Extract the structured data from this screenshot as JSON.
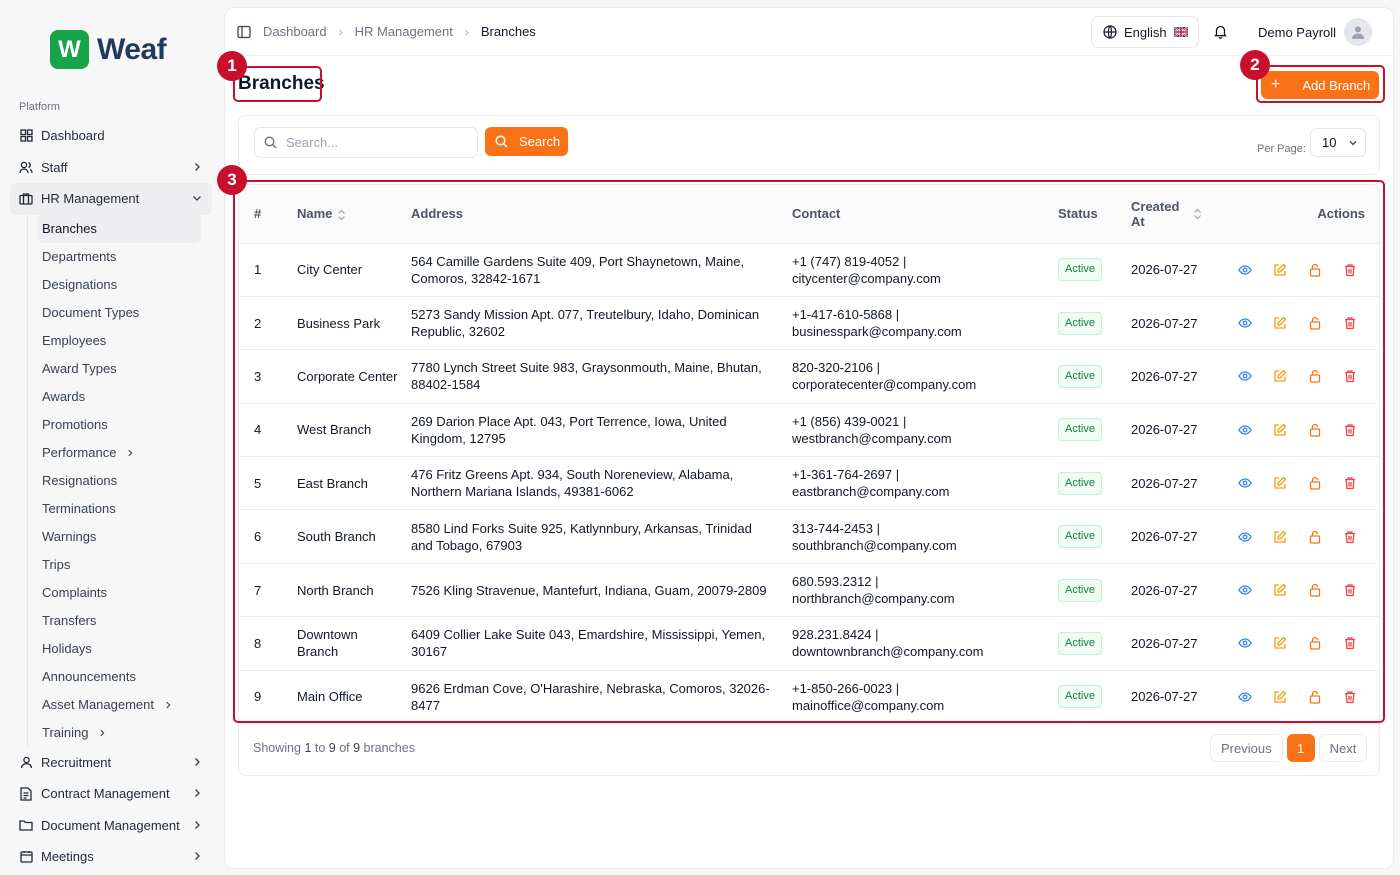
{
  "brand": {
    "logo_letter": "W",
    "name": "Weaf"
  },
  "sidebar": {
    "section_label": "Platform",
    "items": [
      {
        "label": "Dashboard"
      },
      {
        "label": "Staff"
      },
      {
        "label": "HR Management"
      }
    ],
    "hr_sub": [
      {
        "label": "Branches"
      },
      {
        "label": "Departments"
      },
      {
        "label": "Designations"
      },
      {
        "label": "Document Types"
      },
      {
        "label": "Employees"
      },
      {
        "label": "Award Types"
      },
      {
        "label": "Awards"
      },
      {
        "label": "Promotions"
      },
      {
        "label": "Performance"
      },
      {
        "label": "Resignations"
      },
      {
        "label": "Terminations"
      },
      {
        "label": "Warnings"
      },
      {
        "label": "Trips"
      },
      {
        "label": "Complaints"
      },
      {
        "label": "Transfers"
      },
      {
        "label": "Holidays"
      },
      {
        "label": "Announcements"
      },
      {
        "label": "Asset Management"
      },
      {
        "label": "Training"
      }
    ],
    "bottom_items": [
      {
        "label": "Recruitment"
      },
      {
        "label": "Contract Management"
      },
      {
        "label": "Document Management"
      },
      {
        "label": "Meetings"
      }
    ]
  },
  "topbar": {
    "breadcrumb": [
      "Dashboard",
      "HR Management",
      "Branches"
    ],
    "language": "English",
    "user_name": "Demo Payroll"
  },
  "page": {
    "title": "Branches",
    "add_button": "Add Branch",
    "search_placeholder": "Search...",
    "search_button": "Search",
    "per_page_label": "Per Page:",
    "per_page_value": "10"
  },
  "table": {
    "headers": {
      "num": "#",
      "name": "Name",
      "address": "Address",
      "contact": "Contact",
      "status": "Status",
      "created": "Created At",
      "actions": "Actions"
    },
    "rows": [
      {
        "num": "1",
        "name": "City Center",
        "address": "564 Camille Gardens Suite 409, Port Shaynetown, Maine, Comoros, 32842-1671",
        "phone": "+1 (747) 819-4052 |",
        "email": "citycenter@company.com",
        "status": "Active",
        "created": "2026-07-27"
      },
      {
        "num": "2",
        "name": "Business Park",
        "address": "5273 Sandy Mission Apt. 077, Treutelbury, Idaho, Dominican Republic, 32602",
        "phone": "+1-417-610-5868 |",
        "email": "businesspark@company.com",
        "status": "Active",
        "created": "2026-07-27"
      },
      {
        "num": "3",
        "name": "Corporate Center",
        "address": "7780 Lynch Street Suite 983, Graysonmouth, Maine, Bhutan, 88402-1584",
        "phone": "820-320-2106 |",
        "email": "corporatecenter@company.com",
        "status": "Active",
        "created": "2026-07-27"
      },
      {
        "num": "4",
        "name": "West Branch",
        "address": "269 Darion Place Apt. 043, Port Terrence, Iowa, United Kingdom, 12795",
        "phone": "+1 (856) 439-0021 |",
        "email": "westbranch@company.com",
        "status": "Active",
        "created": "2026-07-27"
      },
      {
        "num": "5",
        "name": "East Branch",
        "address": "476 Fritz Greens Apt. 934, South Noreneview, Alabama, Northern Mariana Islands, 49381-6062",
        "phone": "+1-361-764-2697 |",
        "email": "eastbranch@company.com",
        "status": "Active",
        "created": "2026-07-27"
      },
      {
        "num": "6",
        "name": "South Branch",
        "address": "8580 Lind Forks Suite 925, Katlynnbury, Arkansas, Trinidad and Tobago, 67903",
        "phone": "313-744-2453 |",
        "email": "southbranch@company.com",
        "status": "Active",
        "created": "2026-07-27"
      },
      {
        "num": "7",
        "name": "North Branch",
        "address": "7526 Kling Stravenue, Mantefurt, Indiana, Guam, 20079-2809",
        "phone": "680.593.2312 |",
        "email": "northbranch@company.com",
        "status": "Active",
        "created": "2026-07-27"
      },
      {
        "num": "8",
        "name": "Downtown Branch",
        "address": "6409 Collier Lake Suite 043, Emardshire, Mississippi, Yemen, 30167",
        "phone": "928.231.8424 |",
        "email": "downtownbranch@company.com",
        "status": "Active",
        "created": "2026-07-27"
      },
      {
        "num": "9",
        "name": "Main Office",
        "address": "9626 Erdman Cove, O'Harashire, Nebraska, Comoros, 32026-8477",
        "phone": "+1-850-266-0023 |",
        "email": "mainoffice@company.com",
        "status": "Active",
        "created": "2026-07-27"
      }
    ]
  },
  "footer": {
    "prefix": "Showing ",
    "from": "1",
    "to_word": " to ",
    "to": "9",
    "of_word": " of ",
    "total": "9",
    "suffix": " branches",
    "prev": "Previous",
    "current_page": "1",
    "next": "Next"
  },
  "annotations": [
    "1",
    "2",
    "3"
  ],
  "colors": {
    "accent": "#f97316",
    "annotation": "#c8102e",
    "brand": "#16a34a",
    "active_badge": "#15803d"
  }
}
